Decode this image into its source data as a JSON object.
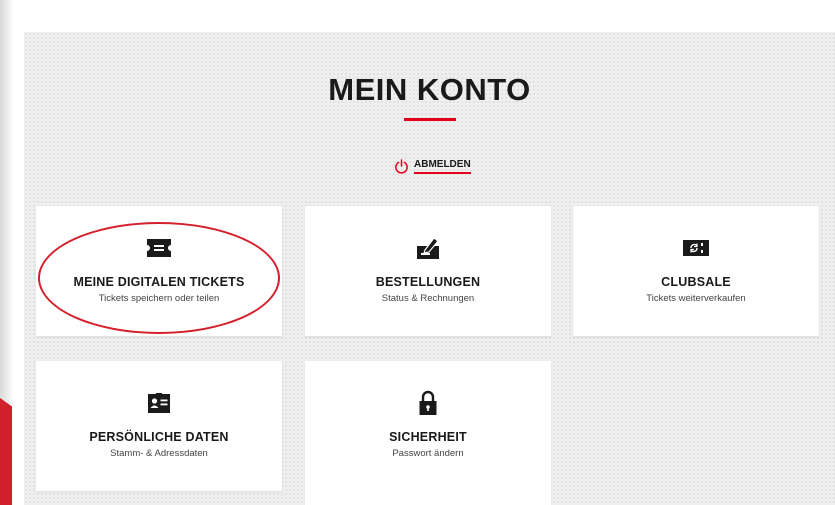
{
  "page": {
    "title": "MEIN KONTO",
    "logout_label": "ABMELDEN"
  },
  "cards": [
    {
      "title": "MEINE DIGITALEN TICKETS",
      "subtitle": "Tickets speichern oder teilen",
      "icon": "ticket-icon",
      "highlighted": true
    },
    {
      "title": "BESTELLUNGEN",
      "subtitle": "Status & Rechnungen",
      "icon": "order-edit-icon"
    },
    {
      "title": "CLUBSALE",
      "subtitle": "Tickets weiterverkaufen",
      "icon": "resale-ticket-icon"
    },
    {
      "title": "PERSÖNLICHE DATEN",
      "subtitle": "Stamm- & Adressdaten",
      "icon": "id-card-icon"
    },
    {
      "title": "SICHERHEIT",
      "subtitle": "Passwort ändern",
      "icon": "lock-icon"
    }
  ],
  "colors": {
    "accent": "#e3001b",
    "highlight": "#d5202c",
    "panel_background": "#efefef",
    "text": "#1a1a1a"
  }
}
